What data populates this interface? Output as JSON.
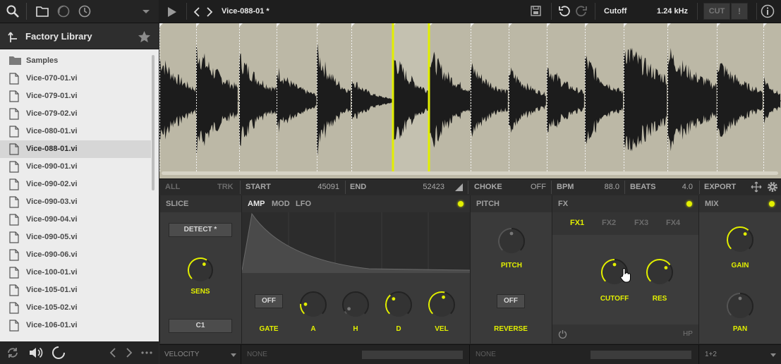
{
  "browser": {
    "library_title": "Factory Library",
    "folder_label": "Samples",
    "files": [
      "Vice-070-01.vi",
      "Vice-079-01.vi",
      "Vice-079-02.vi",
      "Vice-080-01.vi",
      "Vice-088-01.vi",
      "Vice-090-01.vi",
      "Vice-090-02.vi",
      "Vice-090-03.vi",
      "Vice-090-04.vi",
      "Vice-090-05.vi",
      "Vice-090-06.vi",
      "Vice-100-01.vi",
      "Vice-105-01.vi",
      "Vice-105-02.vi",
      "Vice-106-01.vi"
    ],
    "selected_index": 4
  },
  "topbar": {
    "instrument_name": "Vice-088-01 *",
    "param_name": "Cutoff",
    "param_value": "1.24 kHz",
    "cut_label": "CUT",
    "alert_label": "!"
  },
  "slice_bar": {
    "all_label": "ALL",
    "trk_label": "TRK",
    "start_label": "START",
    "start_value": "45091",
    "end_label": "END",
    "end_value": "52423",
    "choke_label": "CHOKE",
    "choke_value": "OFF",
    "bpm_label": "BPM",
    "bpm_value": "88.0",
    "beats_label": "BEATS",
    "beats_value": "4.0",
    "export_label": "EXPORT"
  },
  "slice_panel": {
    "title": "SLICE",
    "detect_label": "DETECT *",
    "sens_label": "SENS",
    "sens_level": 0.62,
    "note_label": "C1"
  },
  "env_panel": {
    "tabs": [
      "AMP",
      "MOD",
      "LFO"
    ],
    "active_tab": "AMP",
    "gate_button": "OFF",
    "gate_label": "GATE",
    "knobs": [
      {
        "label": "A",
        "level": 0.18
      },
      {
        "label": "H",
        "level": 0.05
      },
      {
        "label": "D",
        "level": 0.35
      },
      {
        "label": "VEL",
        "level": 0.55
      }
    ]
  },
  "pitch_panel": {
    "title": "PITCH",
    "pitch_label": "PITCH",
    "pitch_level": 0.5,
    "reverse_button": "OFF",
    "reverse_label": "REVERSE"
  },
  "fx_panel": {
    "title": "FX",
    "tabs": [
      "FX1",
      "FX2",
      "FX3",
      "FX4"
    ],
    "active_tab": "FX1",
    "cutoff_label": "CUTOFF",
    "cutoff_level": 0.5,
    "res_label": "RES",
    "res_level": 0.7,
    "mode_label": "HP"
  },
  "mix_panel": {
    "title": "MIX",
    "gain_label": "GAIN",
    "gain_level": 0.65,
    "pan_label": "PAN",
    "pan_level": 0.5
  },
  "bottom": {
    "velocity_label": "VELOCITY",
    "none1": "NONE",
    "none2": "NONE",
    "output_label": "1+2"
  },
  "colors": {
    "accent": "#e2ef00",
    "waveform_bg": "#bcb8a6",
    "waveform_fg": "#1c1c1c",
    "selected_slice": "#c9c6b7"
  }
}
